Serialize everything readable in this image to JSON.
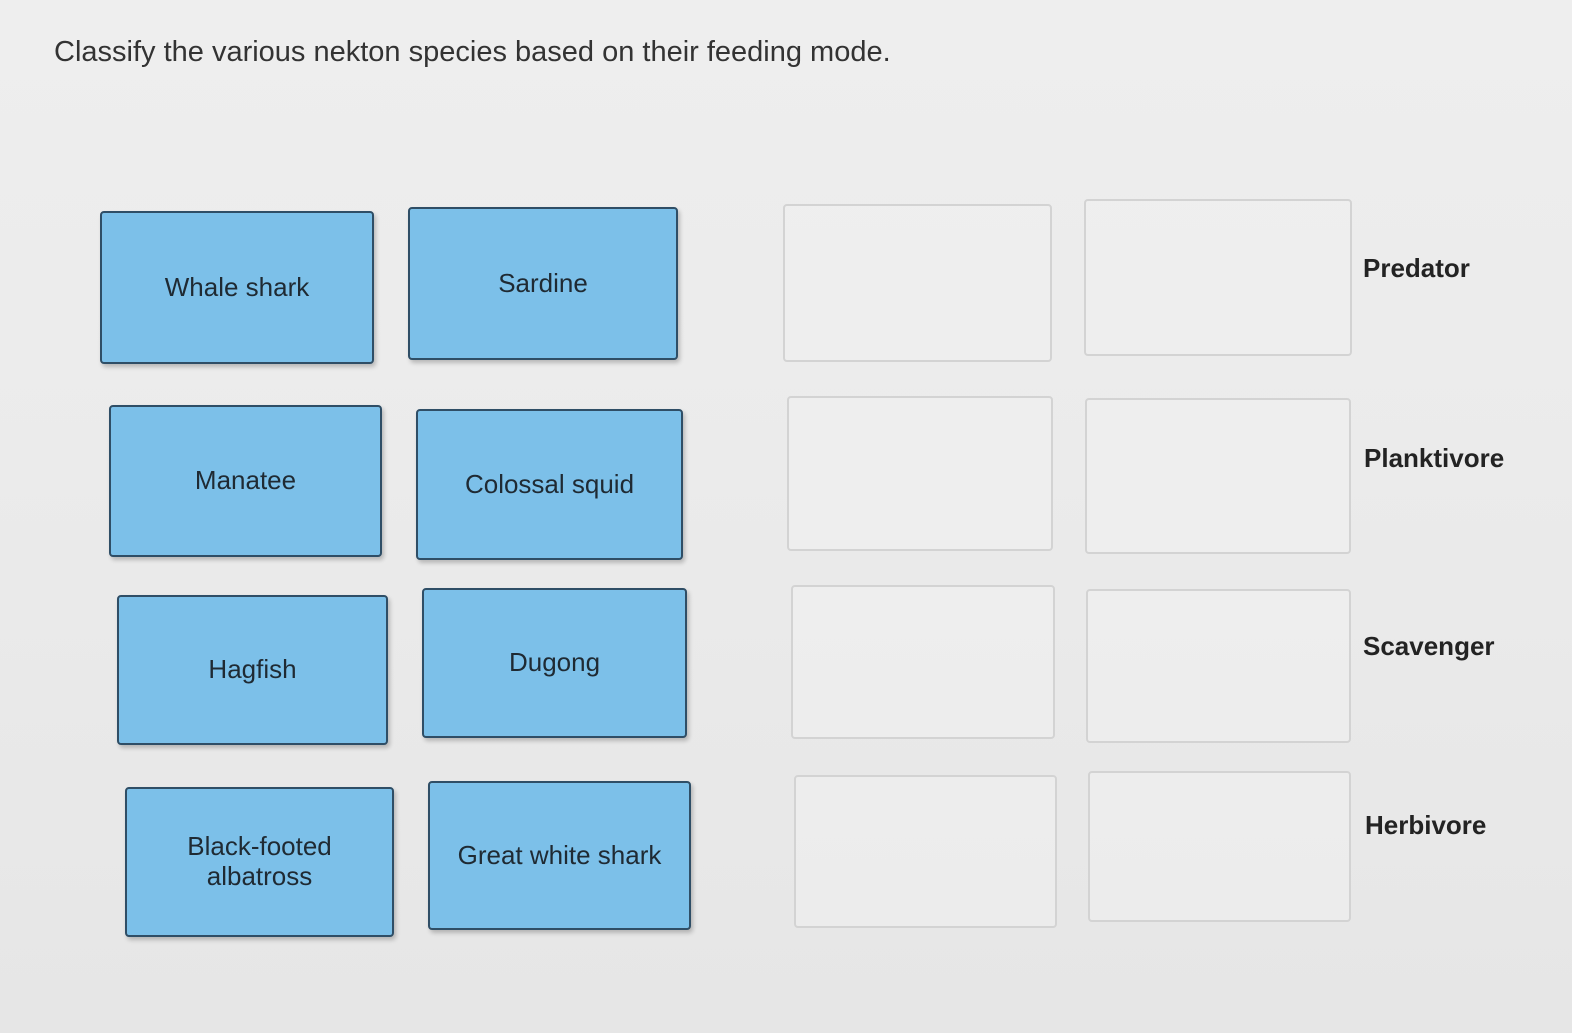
{
  "question": {
    "prompt": "Classify the various nekton species based on their feeding mode."
  },
  "cards": [
    {
      "label": "Whale shark"
    },
    {
      "label": "Sardine"
    },
    {
      "label": "Manatee"
    },
    {
      "label": "Colossal squid"
    },
    {
      "label": "Hagfish"
    },
    {
      "label": "Dugong"
    },
    {
      "label": "Black-footed albatross"
    },
    {
      "label": "Great white shark"
    }
  ],
  "categories": [
    {
      "label": "Predator"
    },
    {
      "label": "Planktivore"
    },
    {
      "label": "Scavenger"
    },
    {
      "label": "Herbivore"
    }
  ],
  "colors": {
    "card_fill": "#7cc0e9",
    "card_border": "#2f4e66",
    "slot_border": "#d3d3d3",
    "background": "#ececec"
  }
}
